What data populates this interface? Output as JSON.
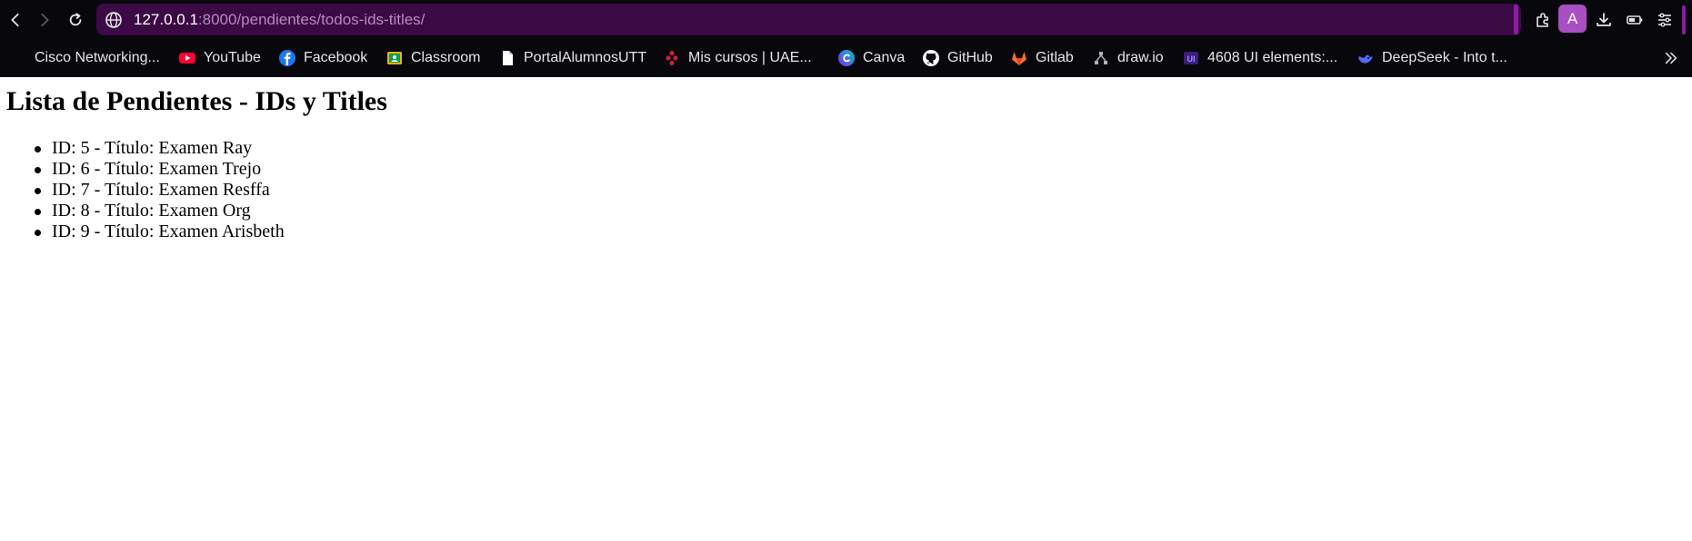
{
  "browser": {
    "url_host": "127.0.0.1",
    "url_rest": ":8000/pendientes/todos-ids-titles/",
    "profile_initial": "A",
    "accent_color": "#8e1ba3",
    "omnibox_color": "#3b0a45",
    "icons": {
      "back": "arrow-left-icon",
      "forward": "arrow-right-icon",
      "reload": "reload-icon",
      "site": "globe-icon",
      "extensions": "puzzle-icon",
      "downloads": "download-icon",
      "battery": "battery-icon",
      "menu": "settings-sliders-icon",
      "bookmarks_overflow": "chevron-double-right-icon"
    }
  },
  "bookmarks": [
    {
      "label": "Cisco Networking...",
      "icon": "cisco-icon"
    },
    {
      "label": "YouTube",
      "icon": "youtube-icon"
    },
    {
      "label": "Facebook",
      "icon": "facebook-icon"
    },
    {
      "label": "Classroom",
      "icon": "classroom-icon"
    },
    {
      "label": "PortalAlumnosUTT",
      "icon": "document-icon"
    },
    {
      "label": "Mis cursos | UAE...",
      "icon": "uae-icon"
    },
    {
      "label": "Canva",
      "icon": "canva-icon"
    },
    {
      "label": "GitHub",
      "icon": "github-icon"
    },
    {
      "label": "Gitlab",
      "icon": "gitlab-icon"
    },
    {
      "label": "draw.io",
      "icon": "drawio-icon"
    },
    {
      "label": "4608 UI elements:...",
      "icon": "ui-elements-icon"
    },
    {
      "label": "DeepSeek - Into t...",
      "icon": "deepseek-icon"
    }
  ],
  "page": {
    "title": "Lista de Pendientes - IDs y Titles",
    "items": [
      "ID: 5 - Título: Examen Ray",
      "ID: 6 - Título: Examen Trejo",
      "ID: 7 - Título: Examen Resffa",
      "ID: 8 - Título: Examen Org",
      "ID: 9 - Título: Examen Arisbeth"
    ]
  }
}
